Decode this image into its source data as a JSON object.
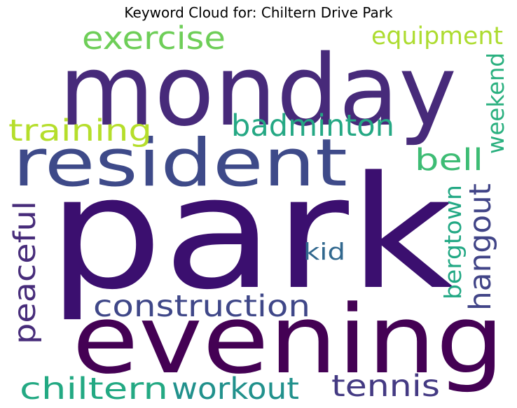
{
  "title": "Keyword Cloud for: Chiltern Drive Park",
  "words": [
    {
      "text": "park",
      "color": "#3b0f6f"
    },
    {
      "text": "monday",
      "color": "#472a7a"
    },
    {
      "text": "evening",
      "color": "#440154"
    },
    {
      "text": "resident",
      "color": "#3e4a89"
    },
    {
      "text": "exercise",
      "color": "#6ece58"
    },
    {
      "text": "equipment",
      "color": "#addc30"
    },
    {
      "text": "weekend",
      "color": "#2ab07f"
    },
    {
      "text": "training",
      "color": "#b5de2b"
    },
    {
      "text": "badminton",
      "color": "#25a884"
    },
    {
      "text": "bell",
      "color": "#3dbc74"
    },
    {
      "text": "peaceful",
      "color": "#472c7a"
    },
    {
      "text": "hangout",
      "color": "#414487"
    },
    {
      "text": "bergtown",
      "color": "#22a884"
    },
    {
      "text": "kid",
      "color": "#31688e"
    },
    {
      "text": "construction",
      "color": "#3f4788"
    },
    {
      "text": "chiltern",
      "color": "#23a983"
    },
    {
      "text": "workout",
      "color": "#21918c"
    },
    {
      "text": "tennis",
      "color": "#443a83"
    }
  ]
}
